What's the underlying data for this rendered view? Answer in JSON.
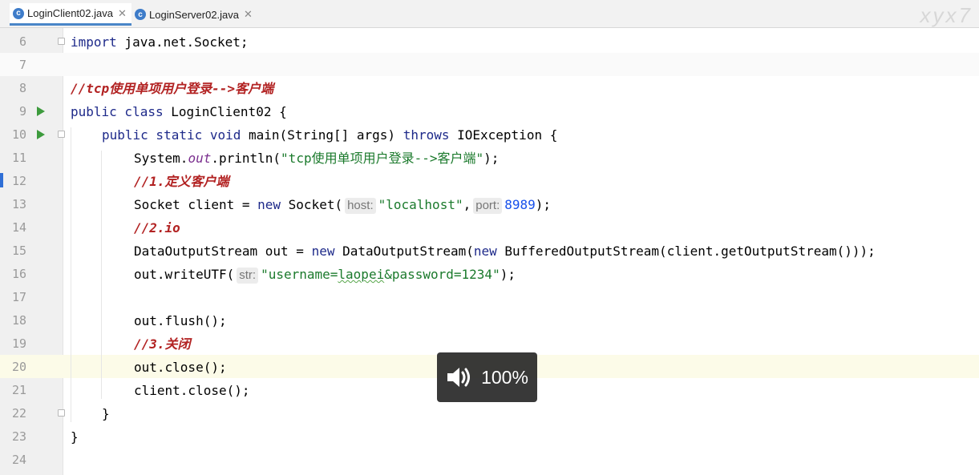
{
  "tabs": [
    {
      "label": "LoginClient02.java",
      "icon": "java-class-icon",
      "active": true
    },
    {
      "label": "LoginServer02.java",
      "icon": "java-class-icon",
      "active": false
    }
  ],
  "watermark": "xyx7",
  "lines": [
    {
      "number": "6"
    },
    {
      "number": "7"
    },
    {
      "number": "8"
    },
    {
      "number": "9"
    },
    {
      "number": "10"
    },
    {
      "number": "11"
    },
    {
      "number": "12"
    },
    {
      "number": "13"
    },
    {
      "number": "14"
    },
    {
      "number": "15"
    },
    {
      "number": "16"
    },
    {
      "number": "17"
    },
    {
      "number": "18"
    },
    {
      "number": "19"
    },
    {
      "number": "20"
    },
    {
      "number": "21"
    },
    {
      "number": "22"
    },
    {
      "number": "23"
    },
    {
      "number": "24"
    }
  ],
  "code": {
    "l6_kw": "import",
    "l6_rest": " java.net.Socket;",
    "l8_comment": "//tcp使用单项用户登录-->客户端",
    "l9_kw": "public class",
    "l9_rest": " LoginClient02 {",
    "l10_kw": "public static void",
    "l10_mid": " main(String[] args) ",
    "l10_kw2": "throws",
    "l10_rest": " IOException {",
    "l11_a": "System.",
    "l11_out": "out",
    "l11_b": ".println(",
    "l11_str": "\"tcp使用单项用户登录-->客户端\"",
    "l11_c": ");",
    "l12_comment": "//1.定义客户端",
    "l13_a": "Socket client = ",
    "l13_new": "new",
    "l13_b": " Socket(",
    "l13_hint1": "host:",
    "l13_str": "\"localhost\"",
    "l13_c": ",",
    "l13_hint2": "port:",
    "l13_num": "8989",
    "l13_d": ");",
    "l14_comment": "//2.io",
    "l15_a": "DataOutputStream out = ",
    "l15_new": "new",
    "l15_b": " DataOutputStream(",
    "l15_new2": "new",
    "l15_c": " BufferedOutputStream(client.getOutputStream()));",
    "l16_a": "out.writeUTF(",
    "l16_hint": "str:",
    "l16_str1": "\"username=",
    "l16_str2": "laopei",
    "l16_str3": "&password=1234\"",
    "l16_b": ");",
    "l18": "out.flush();",
    "l19_comment": "//3.关闭",
    "l20": "out.close();",
    "l21": "client.close();",
    "l22": "}",
    "l23": "}"
  },
  "overlay": {
    "volume": "100%",
    "icon": "speaker-icon"
  }
}
